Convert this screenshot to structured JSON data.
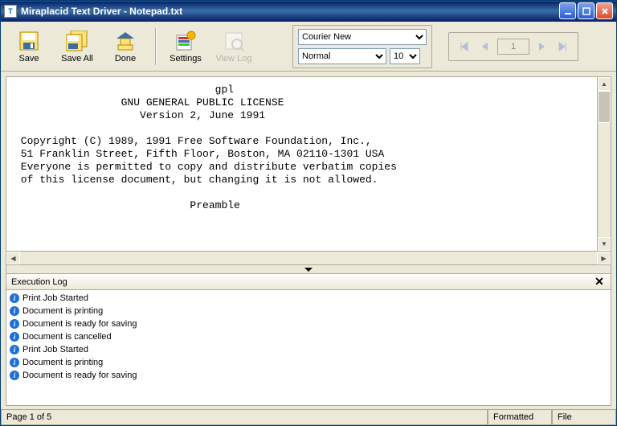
{
  "window": {
    "title": "Miraplacid Text Driver - Notepad.txt"
  },
  "toolbar": {
    "save": "Save",
    "saveall": "Save All",
    "done": "Done",
    "settings": "Settings",
    "viewlog": "View Log"
  },
  "font": {
    "family": "Courier New",
    "style": "Normal",
    "size": "10"
  },
  "nav": {
    "page": "1"
  },
  "document": {
    "lines": [
      "                                gpl",
      "                 GNU GENERAL PUBLIC LICENSE",
      "                    Version 2, June 1991",
      "",
      " Copyright (C) 1989, 1991 Free Software Foundation, Inc.,",
      " 51 Franklin Street, Fifth Floor, Boston, MA 02110-1301 USA",
      " Everyone is permitted to copy and distribute verbatim copies",
      " of this license document, but changing it is not allowed.",
      "",
      "                            Preamble"
    ]
  },
  "log": {
    "title": "Execution Log",
    "items": [
      "Print Job Started",
      "Document is printing",
      "Document is ready for saving",
      "Document is cancelled",
      "Print Job Started",
      "Document is printing",
      "Document is ready for saving"
    ]
  },
  "status": {
    "page": "Page 1 of 5",
    "formatted": "Formatted",
    "file": "File"
  }
}
